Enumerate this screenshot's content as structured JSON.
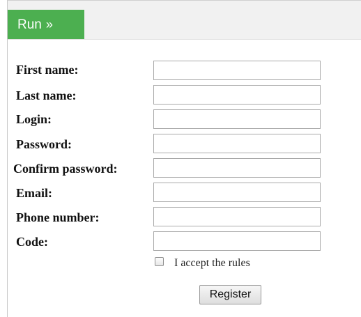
{
  "toolbar": {
    "run_label": "Run",
    "run_chevron": "»"
  },
  "form": {
    "fields": [
      {
        "label": "First name:",
        "value": ""
      },
      {
        "label": "Last name:",
        "value": ""
      },
      {
        "label": "Login:",
        "value": ""
      },
      {
        "label": "Password:",
        "value": ""
      },
      {
        "label": "Confirm password:",
        "value": ""
      },
      {
        "label": "Email:",
        "value": ""
      },
      {
        "label": "Phone number:",
        "value": ""
      },
      {
        "label": "Code:",
        "value": ""
      }
    ],
    "accept_label": "I accept the rules",
    "accept_checked": false,
    "register_label": "Register"
  },
  "colors": {
    "run_button": "#4caf50",
    "toolbar_bg": "#f1f1f1"
  }
}
